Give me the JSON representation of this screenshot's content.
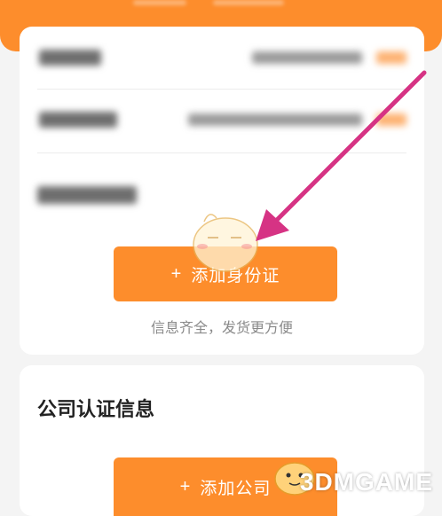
{
  "identity_section": {
    "add_button_icon": "+",
    "add_button_label": "添加身份证",
    "hint": "信息齐全，发货更方便"
  },
  "company_section": {
    "title": "公司认证信息",
    "add_button_icon": "+",
    "add_button_label": "添加公司"
  },
  "watermark": {
    "text": "3DMGAME"
  },
  "colors": {
    "accent": "#fd8d2c",
    "annotation_arrow": "#d63384"
  }
}
